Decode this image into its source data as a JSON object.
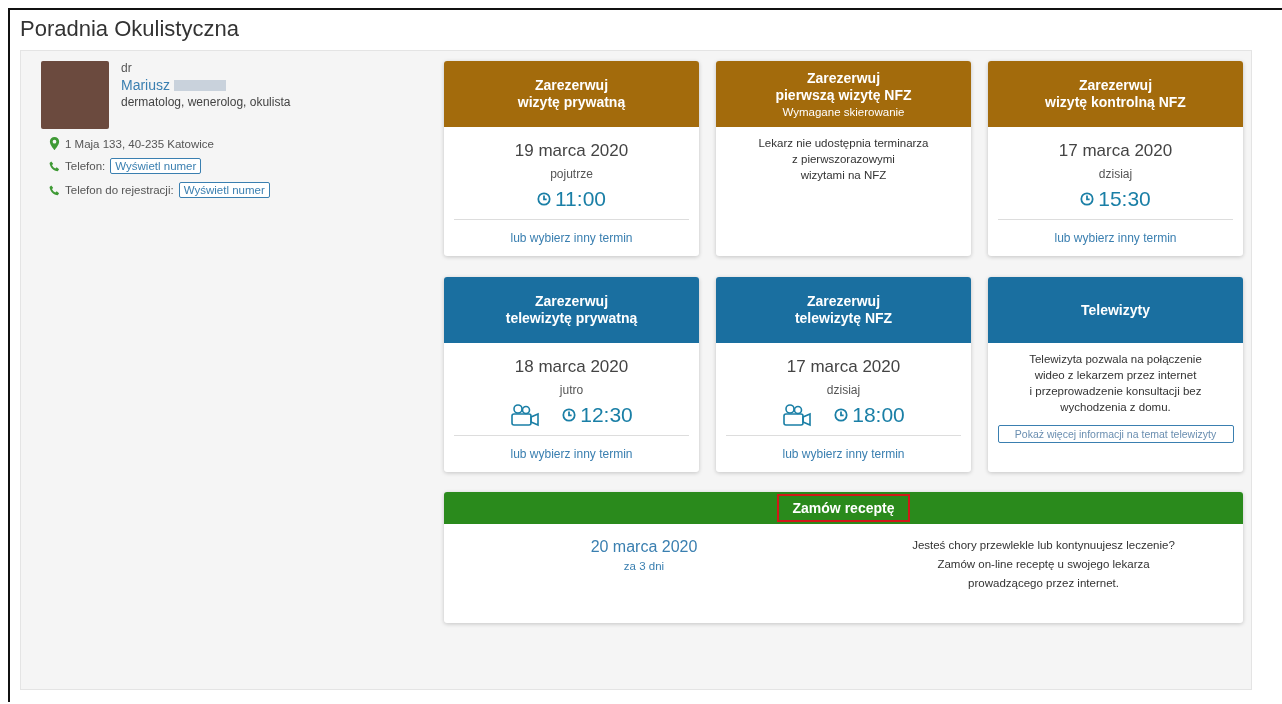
{
  "page_title": "Poradnia Okulistyczna",
  "doctor": {
    "prefix": "dr",
    "name": "Mariusz",
    "specialties": "dermatolog, wenerolog, okulista",
    "address": "1 Maja 133, 40-235 Katowice",
    "phones": [
      {
        "label": "Telefon:",
        "button": "Wyświetl numer"
      },
      {
        "label": "Telefon do rejestracji:",
        "button": "Wyświetl numer"
      }
    ]
  },
  "cards": [
    {
      "kind": "slot",
      "color": "#a36b0c",
      "title": "Zarezerwuj\nwizytę prywatną",
      "date": "19 marca 2020",
      "relative": "pojutrze",
      "time": "11:00",
      "video": false,
      "link": "lub wybierz inny termin"
    },
    {
      "kind": "info",
      "color": "#a36b0c",
      "title": "Zarezerwuj\npierwszą wizytę NFZ",
      "subtitle": "Wymagane skierowanie",
      "text": "Lekarz nie udostępnia terminarza\nz pierwszorazowymi\nwizytami na NFZ"
    },
    {
      "kind": "slot",
      "color": "#a36b0c",
      "title": "Zarezerwuj\nwizytę kontrolną NFZ",
      "date": "17 marca 2020",
      "relative": "dzisiaj",
      "time": "15:30",
      "video": false,
      "link": "lub wybierz inny termin"
    },
    {
      "kind": "slot",
      "color": "#1a6fa0",
      "title": "Zarezerwuj\ntelewizytę prywatną",
      "date": "18 marca 2020",
      "relative": "jutro",
      "time": "12:30",
      "video": true,
      "link": "lub wybierz inny termin"
    },
    {
      "kind": "slot",
      "color": "#1a6fa0",
      "title": "Zarezerwuj\ntelewizytę NFZ",
      "date": "17 marca 2020",
      "relative": "dzisiaj",
      "time": "18:00",
      "video": true,
      "link": "lub wybierz inny termin"
    },
    {
      "kind": "info",
      "color": "#1a6fa0",
      "title": "Telewizyty",
      "text": "Telewizyta pozwala na połączenie\nwideo z lekarzem przez internet\ni przeprowadzenie konsultacji bez\nwychodzenia z domu.",
      "button": "Pokaż więcej informacji na temat telewizyty"
    }
  ],
  "prescription": {
    "title": "Zamów receptę",
    "highlighted": true,
    "date": "20 marca 2020",
    "relative": "za 3 dni",
    "text": "Jesteś chory przewlekle lub kontynuujesz leczenie?\nZamów on-line receptę u swojego lekarza\nprowadzącego przez internet."
  }
}
